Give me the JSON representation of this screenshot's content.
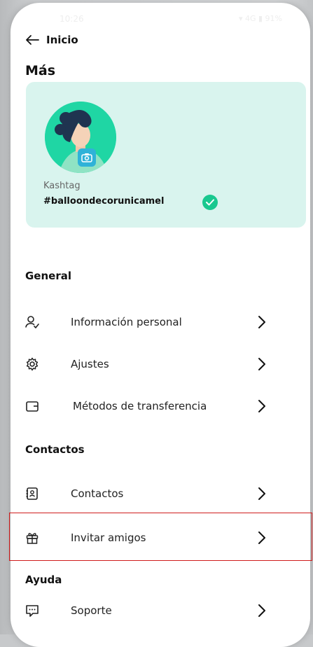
{
  "status": {
    "time": "10:26",
    "icons": "▾ 4G ▮ 91%"
  },
  "nav": {
    "back_label": "Inicio"
  },
  "page": {
    "title": "Más"
  },
  "profile": {
    "kashtag_label": "Kashtag",
    "kashtag_value": "#balloondecorunicamel",
    "card_color": "#d9f4ee",
    "avatar_color": "#1fd6a4",
    "camera_badge_color": "#2fb2d8",
    "verified_color": "#19c88f"
  },
  "sections": {
    "general": "General",
    "contactos": "Contactos",
    "ayuda": "Ayuda"
  },
  "menu": {
    "personal_info": "Información personal",
    "settings": "Ajustes",
    "transfer_methods": "Métodos de transferencia",
    "contacts": "Contactos",
    "invite_friends": "Invitar amigos",
    "support": "Soporte"
  },
  "highlight_color": "#d01c1c"
}
